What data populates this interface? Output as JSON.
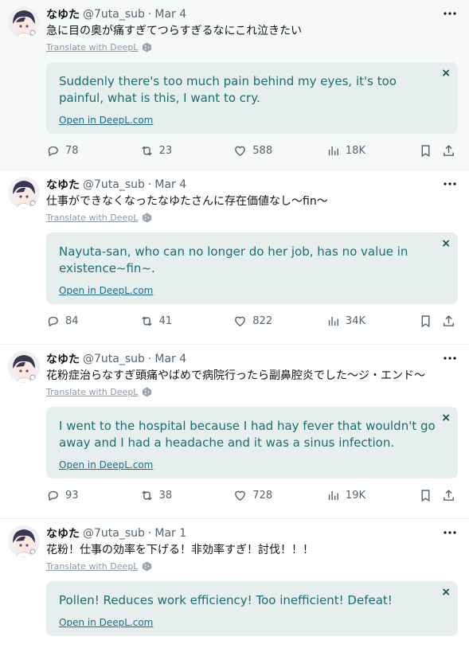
{
  "tweets": [
    {
      "name": "なゆた",
      "handle": "@7uta_sub",
      "date": "Mar 4",
      "text": "急に目の奥が痛すぎてつらすぎるなにこれ泣きたい",
      "translate_label": "Translate with DeepL",
      "translation": "Suddenly there's too much pain behind my eyes, it's too painful, what is this, I want to cry.",
      "open_link": "Open in DeepL.com",
      "replies": "78",
      "retweets": "23",
      "likes": "588",
      "views": "18K"
    },
    {
      "name": "なゆた",
      "handle": "@7uta_sub",
      "date": "Mar 4",
      "text": "仕事ができなくなったなゆたさんに存在価値なし〜fin〜",
      "translate_label": "Translate with DeepL",
      "translation": "Nayuta-san, who can no longer do her job, has no value in existence~fin~.",
      "open_link": "Open in DeepL.com",
      "replies": "84",
      "retweets": "41",
      "likes": "822",
      "views": "34K"
    },
    {
      "name": "なゆた",
      "handle": "@7uta_sub",
      "date": "Mar 4",
      "text": "花粉症治らなすぎ頭痛やばめで病院行ったら副鼻腔炎でした〜ジ・エンド〜",
      "translate_label": "Translate with DeepL",
      "translation": "I went to the hospital because I had hay fever that wouldn't go away and I had a headache and it was a sinus infection.",
      "open_link": "Open in DeepL.com",
      "replies": "93",
      "retweets": "38",
      "likes": "728",
      "views": "19K"
    },
    {
      "name": "なゆた",
      "handle": "@7uta_sub",
      "date": "Mar 1",
      "text": "花粉！仕事の効率を下げる！非効率すぎ！討伐！！！",
      "translate_label": "Translate with DeepL",
      "translation": "Pollen! Reduces work efficiency! Too inefficient! Defeat!",
      "open_link": "Open in DeepL.com"
    }
  ],
  "separator": "·",
  "close_glyph": "×",
  "colors": {
    "translation_bg": "#e6efee",
    "translation_text": "#1a6e70",
    "link": "#1d6a8c",
    "muted": "#536471",
    "highlight_bg": "#f7f9f9"
  },
  "icons": [
    "more-icon",
    "deepl-icon",
    "close-icon",
    "reply-icon",
    "retweet-icon",
    "like-icon",
    "views-icon",
    "bookmark-icon",
    "share-icon"
  ]
}
